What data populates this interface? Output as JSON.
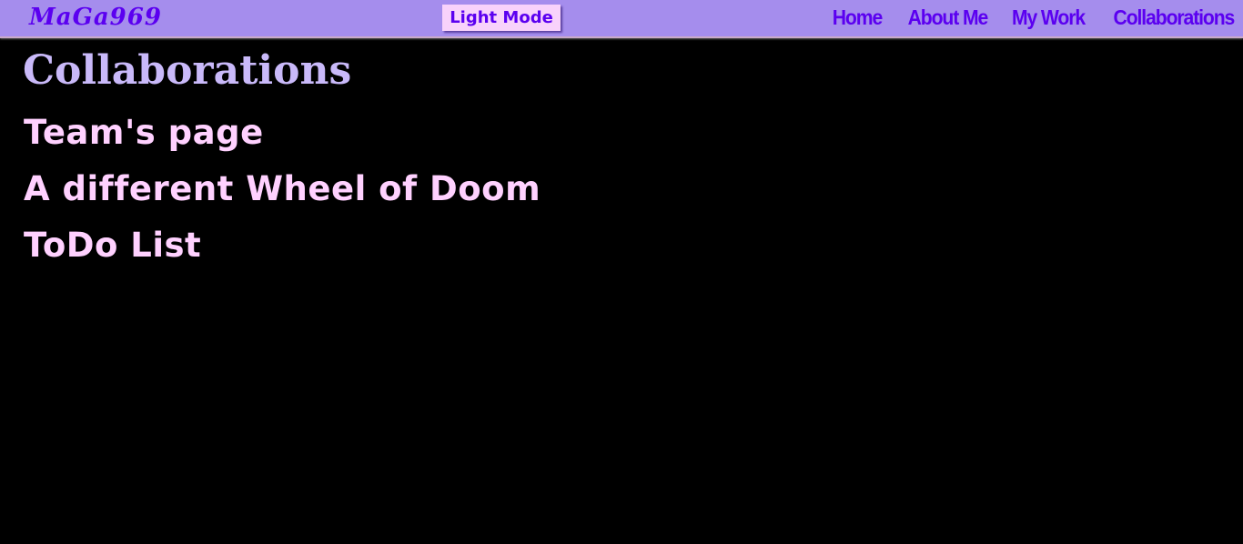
{
  "nav": {
    "logo": "MaGa969",
    "mode_button": "Light Mode",
    "links": [
      "Home",
      "About Me",
      "My Work",
      "Collaborations"
    ]
  },
  "main": {
    "title": "Collaborations",
    "projects": [
      "Team's page",
      "A different Wheel of Doom",
      "ToDo List"
    ]
  },
  "colors": {
    "nav_bg": "#a58ded",
    "nav_text": "#5b00f0",
    "button_bg": "#f8d2fb",
    "title": "#c9b9f9",
    "link": "#ffd1ff",
    "background": "#000000"
  }
}
